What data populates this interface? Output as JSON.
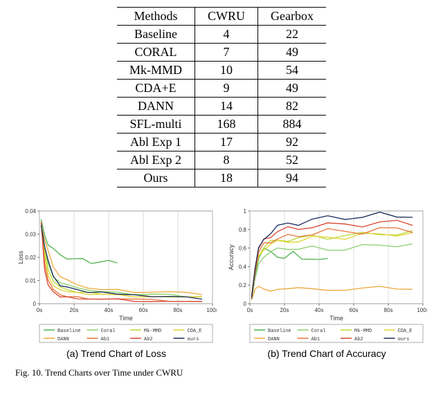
{
  "table": {
    "headers": [
      "Methods",
      "CWRU",
      "Gearbox"
    ],
    "rows": [
      [
        "Baseline",
        "4",
        "22"
      ],
      [
        "CORAL",
        "7",
        "49"
      ],
      [
        "Mk-MMD",
        "10",
        "54"
      ],
      [
        "CDA+E",
        "9",
        "49"
      ],
      [
        "DANN",
        "14",
        "82"
      ],
      [
        "SFL-multi",
        "168",
        "884"
      ],
      [
        "Abl Exp 1",
        "17",
        "92"
      ],
      [
        "Abl Exp 2",
        "8",
        "52"
      ],
      [
        "Ours",
        "18",
        "94"
      ]
    ]
  },
  "subcaptions": {
    "a": "(a) Trend Chart of Loss",
    "b": "(b) Trend Chart of Accuracy"
  },
  "fig_caption": "Fig. 10.  Trend Charts over Time under CWRU",
  "colors": {
    "Baseline": "#4fb24f",
    "Coral": "#8bcf6a",
    "Mk-MMD": "#bada33",
    "CDA_E": "#e0d32f",
    "DANN": "#eda83b",
    "Ab1": "#e6733a",
    "Ab2": "#d9452e",
    "ours": "#1a2a5a"
  },
  "chart_data": [
    {
      "id": "loss",
      "type": "line",
      "title": "",
      "xlabel": "Time",
      "ylabel": "Loss",
      "xlim": [
        0,
        100
      ],
      "ylim": [
        0,
        0.04
      ],
      "xticks": [
        0,
        20,
        40,
        60,
        80,
        100
      ],
      "xtick_labels": [
        "0s",
        "20s",
        "40s",
        "60s",
        "80s",
        "100s"
      ],
      "yticks": [
        0,
        0.01,
        0.02,
        0.03,
        0.04
      ],
      "legend": [
        "Baseline",
        "Coral",
        "Mk-MMD",
        "CDA_E",
        "DANN",
        "Ab1",
        "Ab2",
        "ours"
      ],
      "series": [
        {
          "name": "Baseline",
          "x": [
            1,
            3,
            5,
            8,
            12,
            16,
            20,
            25,
            30,
            35,
            40,
            45
          ],
          "y": [
            0.035,
            0.03,
            0.026,
            0.023,
            0.021,
            0.02,
            0.019,
            0.019,
            0.018,
            0.018,
            0.018,
            0.018
          ]
        },
        {
          "name": "Coral",
          "x": [
            1,
            3,
            5,
            8,
            12,
            16,
            22,
            28,
            36,
            45,
            55,
            65,
            75,
            85,
            94
          ],
          "y": [
            0.035,
            0.024,
            0.017,
            0.012,
            0.009,
            0.008,
            0.007,
            0.006,
            0.005,
            0.005,
            0.004,
            0.004,
            0.004,
            0.003,
            0.003
          ]
        },
        {
          "name": "Mk-MMD",
          "x": [
            1,
            3,
            5,
            8,
            12,
            16,
            22,
            28,
            36,
            45,
            55,
            65,
            75,
            85,
            94
          ],
          "y": [
            0.035,
            0.022,
            0.015,
            0.01,
            0.007,
            0.006,
            0.005,
            0.005,
            0.004,
            0.004,
            0.004,
            0.003,
            0.003,
            0.003,
            0.003
          ]
        },
        {
          "name": "CDA_E",
          "x": [
            1,
            3,
            5,
            8,
            12,
            16,
            22,
            28,
            36,
            45,
            55,
            65,
            75,
            85,
            94
          ],
          "y": [
            0.035,
            0.02,
            0.012,
            0.008,
            0.006,
            0.005,
            0.005,
            0.004,
            0.004,
            0.004,
            0.003,
            0.003,
            0.003,
            0.003,
            0.003
          ]
        },
        {
          "name": "DANN",
          "x": [
            1,
            3,
            5,
            8,
            12,
            16,
            22,
            28,
            36,
            45,
            55,
            65,
            75,
            85,
            94
          ],
          "y": [
            0.035,
            0.028,
            0.022,
            0.016,
            0.012,
            0.01,
            0.008,
            0.007,
            0.006,
            0.006,
            0.005,
            0.005,
            0.005,
            0.005,
            0.004
          ]
        },
        {
          "name": "Ab1",
          "x": [
            1,
            3,
            5,
            8,
            12,
            16,
            22,
            28,
            36,
            45,
            55,
            65,
            75,
            85,
            94
          ],
          "y": [
            0.035,
            0.018,
            0.01,
            0.006,
            0.004,
            0.003,
            0.003,
            0.002,
            0.002,
            0.002,
            0.002,
            0.002,
            0.001,
            0.001,
            0.001
          ]
        },
        {
          "name": "Ab2",
          "x": [
            1,
            3,
            5,
            8,
            12,
            16,
            22,
            28,
            36,
            45,
            55,
            65,
            75,
            85,
            94
          ],
          "y": [
            0.035,
            0.015,
            0.008,
            0.005,
            0.003,
            0.003,
            0.002,
            0.002,
            0.002,
            0.002,
            0.001,
            0.001,
            0.001,
            0.001,
            0.001
          ]
        },
        {
          "name": "ours",
          "x": [
            1,
            3,
            5,
            8,
            12,
            16,
            22,
            28,
            36,
            45,
            55,
            65,
            75,
            85,
            94
          ],
          "y": [
            0.035,
            0.025,
            0.018,
            0.012,
            0.008,
            0.007,
            0.006,
            0.005,
            0.005,
            0.004,
            0.004,
            0.003,
            0.003,
            0.003,
            0.002
          ]
        }
      ]
    },
    {
      "id": "accuracy",
      "type": "line",
      "title": "",
      "xlabel": "Time",
      "ylabel": "Accuracy",
      "xlim": [
        0,
        100
      ],
      "ylim": [
        0,
        1.0
      ],
      "xticks": [
        0,
        20,
        40,
        60,
        80,
        100
      ],
      "xtick_labels": [
        "0s",
        "20s",
        "40s",
        "60s",
        "80s",
        "100s"
      ],
      "yticks": [
        0,
        0.2,
        0.4,
        0.6,
        0.8,
        1.0
      ],
      "legend": [
        "Baseline",
        "Coral",
        "Mk-MMD",
        "CDA_E",
        "DANN",
        "Ab1",
        "Ab2",
        "ours"
      ],
      "series": [
        {
          "name": "Baseline",
          "x": [
            1,
            3,
            5,
            8,
            12,
            16,
            20,
            25,
            30,
            35,
            40,
            45
          ],
          "y": [
            0.08,
            0.3,
            0.5,
            0.58,
            0.56,
            0.52,
            0.48,
            0.55,
            0.5,
            0.48,
            0.46,
            0.5
          ]
        },
        {
          "name": "Coral",
          "x": [
            1,
            3,
            5,
            8,
            12,
            16,
            22,
            28,
            36,
            45,
            55,
            65,
            75,
            85,
            94
          ],
          "y": [
            0.05,
            0.26,
            0.42,
            0.52,
            0.56,
            0.58,
            0.6,
            0.6,
            0.6,
            0.58,
            0.6,
            0.62,
            0.62,
            0.64,
            0.64
          ]
        },
        {
          "name": "Mk-MMD",
          "x": [
            1,
            3,
            5,
            8,
            12,
            16,
            22,
            28,
            36,
            45,
            55,
            65,
            75,
            85,
            94
          ],
          "y": [
            0.1,
            0.35,
            0.52,
            0.62,
            0.66,
            0.68,
            0.7,
            0.7,
            0.72,
            0.72,
            0.74,
            0.74,
            0.76,
            0.76,
            0.76
          ]
        },
        {
          "name": "CDA_E",
          "x": [
            1,
            3,
            5,
            8,
            12,
            16,
            22,
            28,
            36,
            45,
            55,
            65,
            75,
            85,
            94
          ],
          "y": [
            0.08,
            0.34,
            0.5,
            0.6,
            0.64,
            0.66,
            0.68,
            0.68,
            0.7,
            0.72,
            0.72,
            0.74,
            0.74,
            0.76,
            0.76
          ]
        },
        {
          "name": "DANN",
          "x": [
            1,
            3,
            5,
            8,
            12,
            16,
            22,
            28,
            36,
            45,
            55,
            65,
            75,
            85,
            94
          ],
          "y": [
            0.04,
            0.16,
            0.18,
            0.16,
            0.14,
            0.15,
            0.16,
            0.18,
            0.16,
            0.14,
            0.15,
            0.17,
            0.18,
            0.16,
            0.16
          ]
        },
        {
          "name": "Ab1",
          "x": [
            1,
            3,
            5,
            8,
            12,
            16,
            22,
            28,
            36,
            45,
            55,
            65,
            75,
            85,
            94
          ],
          "y": [
            0.06,
            0.34,
            0.54,
            0.64,
            0.68,
            0.7,
            0.72,
            0.74,
            0.76,
            0.78,
            0.78,
            0.78,
            0.8,
            0.8,
            0.8
          ]
        },
        {
          "name": "Ab2",
          "x": [
            1,
            3,
            5,
            8,
            12,
            16,
            22,
            28,
            36,
            45,
            55,
            65,
            75,
            85,
            94
          ],
          "y": [
            0.08,
            0.4,
            0.58,
            0.68,
            0.74,
            0.78,
            0.8,
            0.82,
            0.84,
            0.84,
            0.86,
            0.86,
            0.86,
            0.88,
            0.88
          ]
        },
        {
          "name": "ours",
          "x": [
            1,
            3,
            5,
            8,
            12,
            16,
            22,
            28,
            36,
            45,
            55,
            65,
            75,
            85,
            94
          ],
          "y": [
            0.06,
            0.38,
            0.58,
            0.7,
            0.78,
            0.82,
            0.86,
            0.88,
            0.9,
            0.92,
            0.94,
            0.94,
            0.95,
            0.95,
            0.96
          ]
        }
      ]
    }
  ]
}
